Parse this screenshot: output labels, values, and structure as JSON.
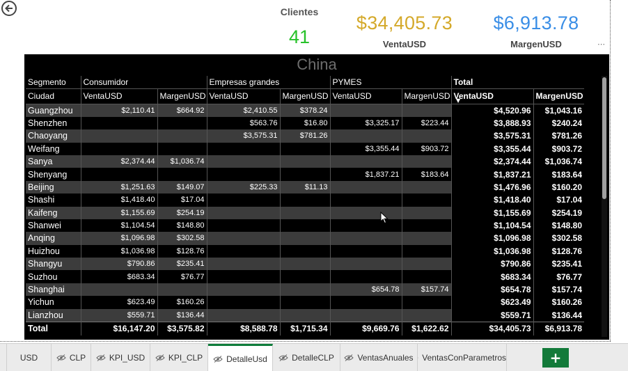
{
  "kpis": {
    "clientes_label": "Clientes",
    "clientes_value": "41",
    "venta_value": "$34,405.73",
    "venta_label": "VentaUSD",
    "margen_value": "$6,913.78",
    "margen_label": "MargenUSD",
    "more_options": "⋯"
  },
  "matrix": {
    "title": "China",
    "header1": {
      "segmento": "Segmento",
      "consumidor": "Consumidor",
      "empresas": "Empresas grandes",
      "pymes": "PYMES",
      "total": "Total"
    },
    "header2": {
      "ciudad": "Ciudad",
      "c1": "VentaUSD",
      "c2": "MargenUSD",
      "c3": "VentaUSD",
      "c4": "MargenUSD",
      "c5": "VentaUSD",
      "c6": "MargenUSD",
      "c7": "VentaUSD",
      "c8": "MargenUSD"
    },
    "rows": [
      {
        "city": "Guangzhou",
        "cv": "$2,110.41",
        "cm": "$664.92",
        "ev": "$2,410.55",
        "em": "$378.24",
        "pv": "",
        "pm": "",
        "tv": "$4,520.96",
        "tm": "$1,043.16"
      },
      {
        "city": "Shenzhen",
        "cv": "",
        "cm": "",
        "ev": "$563.76",
        "em": "$16.80",
        "pv": "$3,325.17",
        "pm": "$223.44",
        "tv": "$3,888.93",
        "tm": "$240.24"
      },
      {
        "city": "Chaoyang",
        "cv": "",
        "cm": "",
        "ev": "$3,575.31",
        "em": "$781.26",
        "pv": "",
        "pm": "",
        "tv": "$3,575.31",
        "tm": "$781.26"
      },
      {
        "city": "Weifang",
        "cv": "",
        "cm": "",
        "ev": "",
        "em": "",
        "pv": "$3,355.44",
        "pm": "$903.72",
        "tv": "$3,355.44",
        "tm": "$903.72"
      },
      {
        "city": "Sanya",
        "cv": "$2,374.44",
        "cm": "$1,036.74",
        "ev": "",
        "em": "",
        "pv": "",
        "pm": "",
        "tv": "$2,374.44",
        "tm": "$1,036.74"
      },
      {
        "city": "Shenyang",
        "cv": "",
        "cm": "",
        "ev": "",
        "em": "",
        "pv": "$1,837.21",
        "pm": "$183.64",
        "tv": "$1,837.21",
        "tm": "$183.64"
      },
      {
        "city": "Beijing",
        "cv": "$1,251.63",
        "cm": "$149.07",
        "ev": "$225.33",
        "em": "$11.13",
        "pv": "",
        "pm": "",
        "tv": "$1,476.96",
        "tm": "$160.20"
      },
      {
        "city": "Shashi",
        "cv": "$1,418.40",
        "cm": "$17.04",
        "ev": "",
        "em": "",
        "pv": "",
        "pm": "",
        "tv": "$1,418.40",
        "tm": "$17.04"
      },
      {
        "city": "Kaifeng",
        "cv": "$1,155.69",
        "cm": "$254.19",
        "ev": "",
        "em": "",
        "pv": "",
        "pm": "",
        "tv": "$1,155.69",
        "tm": "$254.19"
      },
      {
        "city": "Shanwei",
        "cv": "$1,104.54",
        "cm": "$148.80",
        "ev": "",
        "em": "",
        "pv": "",
        "pm": "",
        "tv": "$1,104.54",
        "tm": "$148.80"
      },
      {
        "city": "Anqing",
        "cv": "$1,096.98",
        "cm": "$302.58",
        "ev": "",
        "em": "",
        "pv": "",
        "pm": "",
        "tv": "$1,096.98",
        "tm": "$302.58"
      },
      {
        "city": "Huizhou",
        "cv": "$1,036.98",
        "cm": "$128.76",
        "ev": "",
        "em": "",
        "pv": "",
        "pm": "",
        "tv": "$1,036.98",
        "tm": "$128.76"
      },
      {
        "city": "Shangyu",
        "cv": "$790.86",
        "cm": "$235.41",
        "ev": "",
        "em": "",
        "pv": "",
        "pm": "",
        "tv": "$790.86",
        "tm": "$235.41"
      },
      {
        "city": "Suzhou",
        "cv": "$683.34",
        "cm": "$76.77",
        "ev": "",
        "em": "",
        "pv": "",
        "pm": "",
        "tv": "$683.34",
        "tm": "$76.77"
      },
      {
        "city": "Shanghai",
        "cv": "",
        "cm": "",
        "ev": "",
        "em": "",
        "pv": "$654.78",
        "pm": "$157.74",
        "tv": "$654.78",
        "tm": "$157.74"
      },
      {
        "city": "Yichun",
        "cv": "$623.49",
        "cm": "$160.26",
        "ev": "",
        "em": "",
        "pv": "",
        "pm": "",
        "tv": "$623.49",
        "tm": "$160.26"
      },
      {
        "city": "Lianzhou",
        "cv": "$559.71",
        "cm": "$136.44",
        "ev": "",
        "em": "",
        "pv": "",
        "pm": "",
        "tv": "$559.71",
        "tm": "$136.44"
      }
    ],
    "total": {
      "city": "Total",
      "cv": "$16,147.20",
      "cm": "$3,575.82",
      "ev": "$8,588.78",
      "em": "$1,715.34",
      "pv": "$9,669.76",
      "pm": "$1,622.62",
      "tv": "$34,405.73",
      "tm": "$6,913.78"
    }
  },
  "tabs": [
    {
      "label": "USD",
      "hidden": false,
      "active": false
    },
    {
      "label": "CLP",
      "hidden": true,
      "active": false
    },
    {
      "label": "KPI_USD",
      "hidden": true,
      "active": false
    },
    {
      "label": "KPI_CLP",
      "hidden": true,
      "active": false
    },
    {
      "label": "DetalleUsd",
      "hidden": true,
      "active": true
    },
    {
      "label": "DetalleCLP",
      "hidden": true,
      "active": false
    },
    {
      "label": "VentasAnuales",
      "hidden": true,
      "active": false
    },
    {
      "label": "VentasConParametros",
      "hidden": true,
      "active": false
    }
  ],
  "add_tab_label": "+",
  "colors": {
    "clientes": "#27c22a",
    "venta": "#d4a92a",
    "margen": "#3a8ee6",
    "tab_accent": "#137a3a"
  }
}
